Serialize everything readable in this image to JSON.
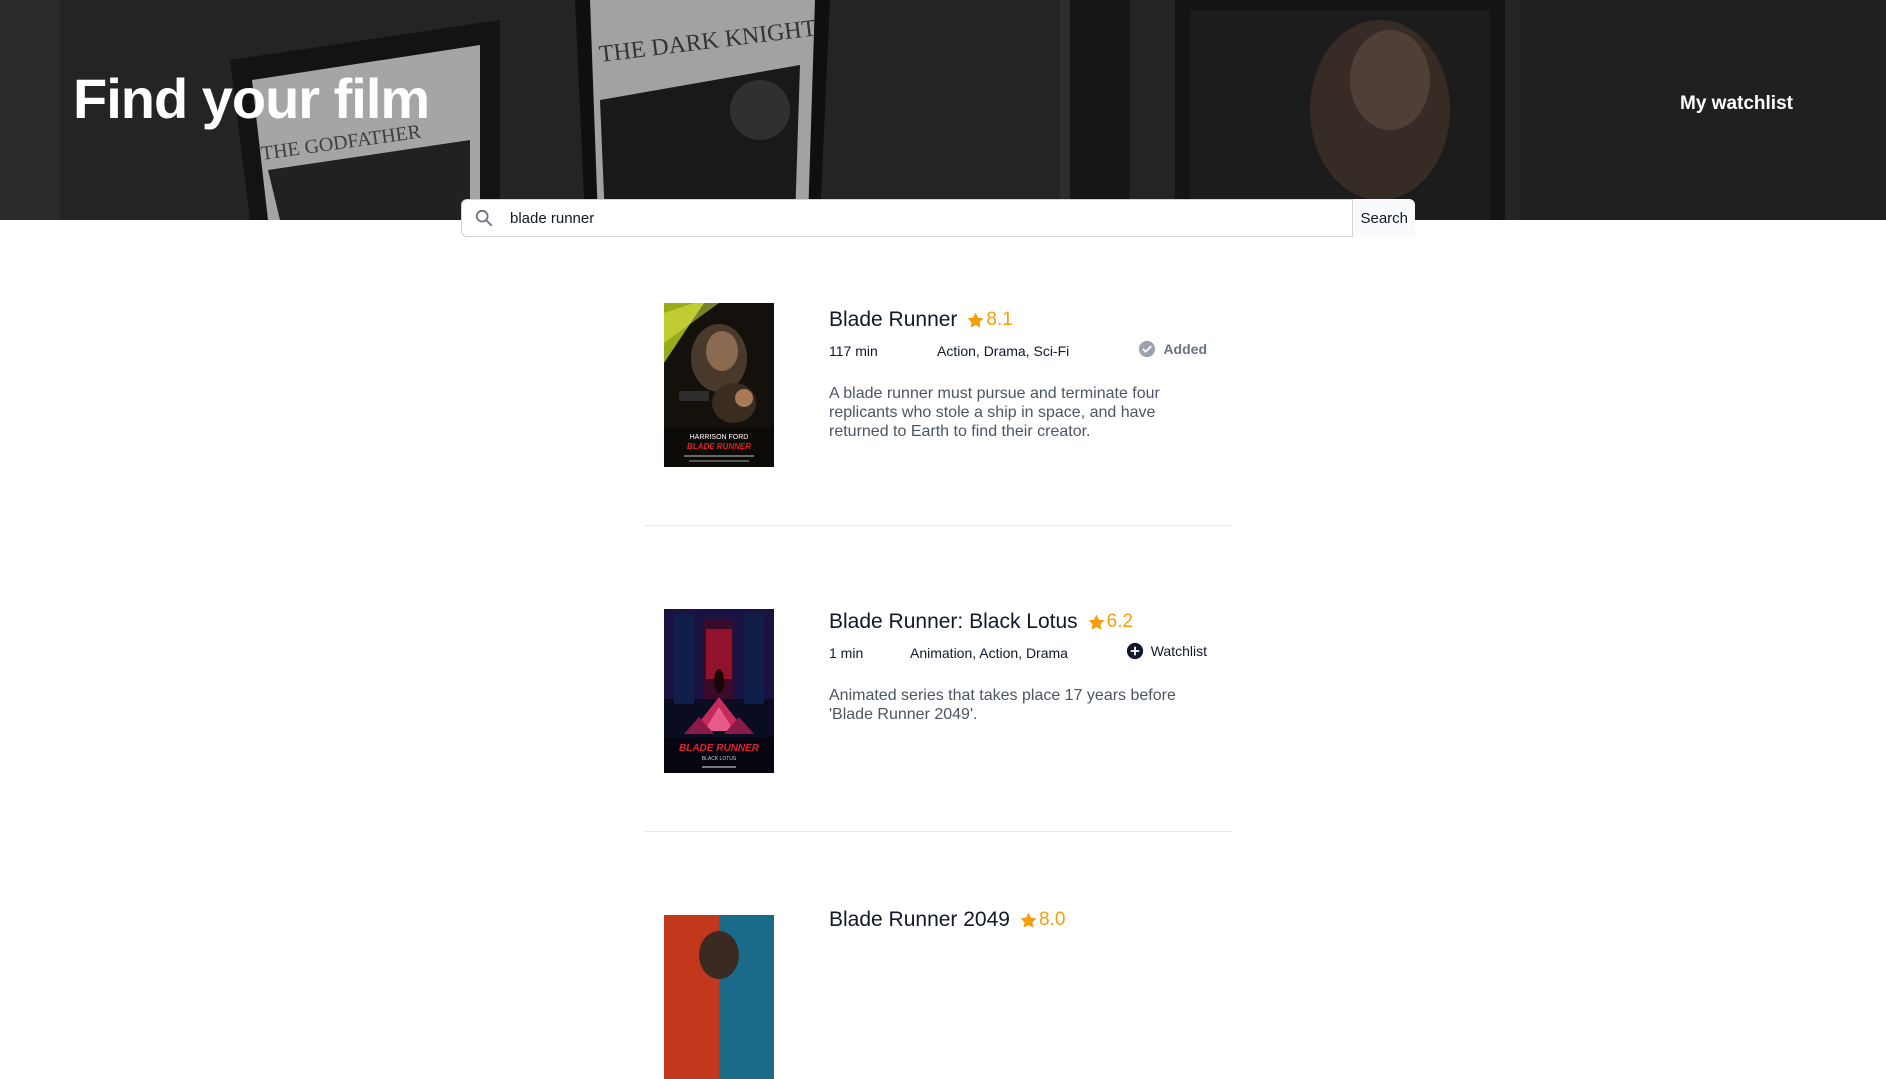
{
  "header": {
    "title": "Find your film",
    "watchlist_link": "My watchlist",
    "background_poster_texts": [
      "THE GODFATHER",
      "THE DARK KNIGHT"
    ]
  },
  "search": {
    "value": "blade runner",
    "placeholder": "Search",
    "button_label": "Search"
  },
  "results": [
    {
      "title": "Blade Runner",
      "rating": "8.1",
      "runtime": "117 min",
      "genres": "Action, Drama, Sci-Fi",
      "watchlist_label": "Added",
      "watchlist_state": "added",
      "plot": "A blade runner must pursue and terminate four replicants who stole a ship in space, and have returned to Earth to find their creator.",
      "poster_texts": [
        "HARRISON FORD",
        "BLADE RUNNER"
      ]
    },
    {
      "title": "Blade Runner: Black Lotus",
      "rating": "6.2",
      "runtime": "1 min",
      "genres": "Animation, Action, Drama",
      "watchlist_label": "Watchlist",
      "watchlist_state": "not-added",
      "plot": "Animated series that takes place 17 years before 'Blade Runner 2049'.",
      "poster_texts": [
        "BLADE RUNNER",
        "BLACK LOTUS"
      ]
    },
    {
      "title": "Blade Runner 2049",
      "rating": "8.0"
    }
  ],
  "colors": {
    "rating": "#f59e0b",
    "text": "#111827",
    "muted": "#6b7280",
    "plot": "#4b5563"
  }
}
